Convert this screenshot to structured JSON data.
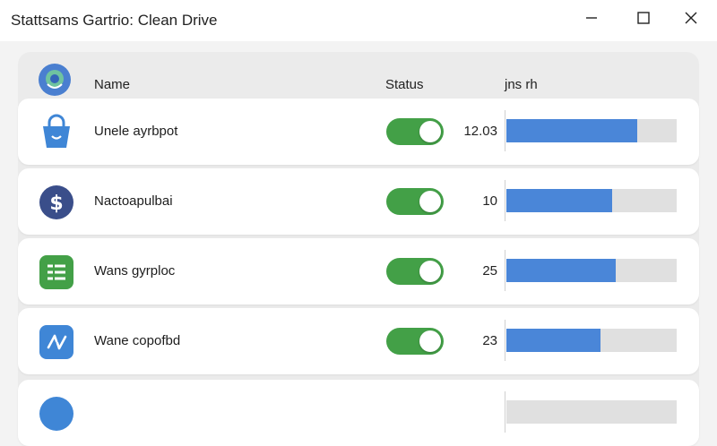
{
  "window": {
    "title": "Stattsams Gartrio: Clean Drive",
    "buttons": [
      "minimize",
      "maximize",
      "close"
    ]
  },
  "columns": {
    "name": "Name",
    "status": "Status",
    "size": "jns rh"
  },
  "colors": {
    "toggle_on": "#43a047",
    "bar_fill": "#4a86d8",
    "bar_track": "#e0e0e0",
    "row_background": "#ffffff",
    "window_background": "#f3f3f3"
  },
  "items": [
    {
      "name": "Unele ayrbpot",
      "icon": "shopping-bag-icon",
      "icon_color": "#3f86d6",
      "enabled": true,
      "value": "12.03",
      "fill": 0.77
    },
    {
      "name": "Nactoapulbai",
      "icon": "dollar-coin-icon",
      "icon_color": "#3a4e8a",
      "enabled": true,
      "value": "10",
      "fill": 0.62
    },
    {
      "name": "Wans gyrploc",
      "icon": "list-document-icon",
      "icon_color": "#43a047",
      "enabled": true,
      "value": "25",
      "fill": 0.64
    },
    {
      "name": "Wane copofbd",
      "icon": "swap-arrows-icon",
      "icon_color": "#3f86d6",
      "enabled": true,
      "value": "23",
      "fill": 0.55
    }
  ]
}
